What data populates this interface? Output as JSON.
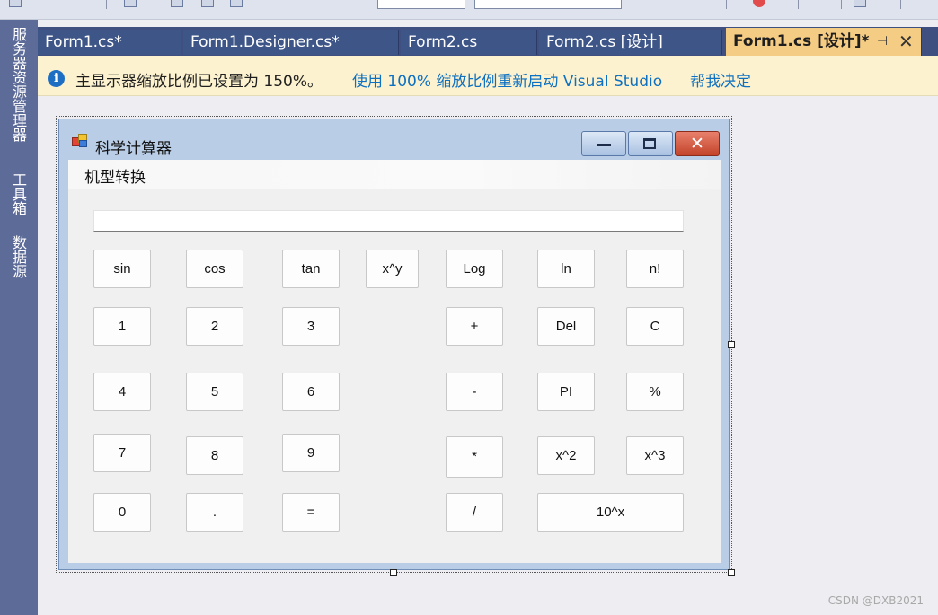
{
  "sidebar": {
    "tabs": [
      "服务器资源管理器",
      "工具箱",
      "数据源"
    ]
  },
  "tabs": [
    {
      "label": "Form1.cs*"
    },
    {
      "label": "Form1.Designer.cs*"
    },
    {
      "label": "Form2.cs"
    },
    {
      "label": "Form2.cs [设计]"
    },
    {
      "label": "Form1.cs [设计]*"
    }
  ],
  "infobar": {
    "icon": "info-icon",
    "message": "主显示器缩放比例已设置为 150%。",
    "restart_link": "使用 100% 缩放比例重新启动 Visual Studio",
    "help_link": "帮我决定"
  },
  "form": {
    "title": "科学计算器",
    "menu": [
      "机型转换"
    ],
    "display_value": "",
    "buttons": [
      [
        "sin",
        "cos",
        "tan",
        "x^y",
        "Log",
        "ln",
        "n!"
      ],
      [
        "1",
        "2",
        "3",
        "+",
        "Del",
        "C"
      ],
      [
        "4",
        "5",
        "6",
        "-",
        "PI",
        "%"
      ],
      [
        "7",
        "8",
        "9",
        "*",
        "x^2",
        "x^3"
      ],
      [
        "0",
        ".",
        "=",
        "/",
        "10^x"
      ]
    ]
  },
  "watermark": "CSDN @DXB2021",
  "colors": {
    "sidebar": "#5d6b99",
    "tab_inactive": "#3d5587",
    "tab_active": "#f5cc84",
    "infobar": "#fcf2cf",
    "link": "#0e70c0"
  }
}
